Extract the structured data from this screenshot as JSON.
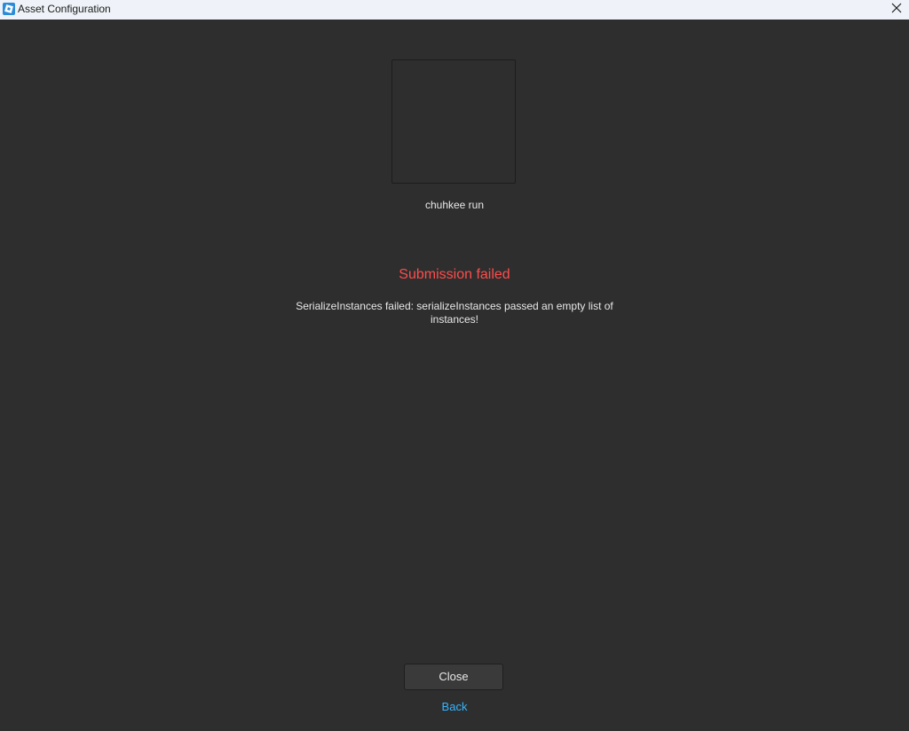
{
  "window": {
    "title": "Asset Configuration",
    "app_icon": "roblox-studio-icon",
    "close_icon": "close-icon"
  },
  "asset": {
    "name": "chuhkee run"
  },
  "status": {
    "title": "Submission failed",
    "message": "SerializeInstances failed: serializeInstances passed an empty list of instances!",
    "title_color": "#ff4c4c"
  },
  "actions": {
    "close_label": "Close",
    "back_label": "Back",
    "link_color": "#35b5ff"
  },
  "colors": {
    "background": "#2e2e2e",
    "titlebar": "#eff3f9"
  }
}
